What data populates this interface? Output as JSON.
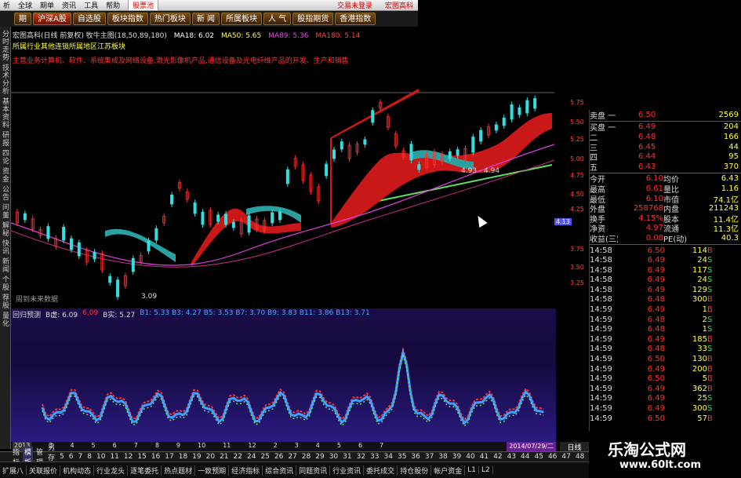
{
  "menubar": {
    "items": [
      "析",
      "全球",
      "期单",
      "资讯",
      "工具",
      "帮助"
    ],
    "brand": "股票池",
    "marquee": [
      "交易未登录",
      "宏图高科"
    ]
  },
  "navbar": {
    "items": [
      "期",
      "沪深A股",
      "自选股",
      "板块指数",
      "热门板块",
      "新 闻",
      "所属板块",
      "人 气",
      "股指期货",
      "香港指数"
    ],
    "active_index": 1
  },
  "left_tabs": [
    "分时走势",
    "技术分析",
    "基本资料",
    "研报",
    "四论",
    "资金",
    "公告",
    "问董",
    "解秘",
    "快讯",
    "新闻",
    "个股",
    "荐股",
    "量化"
  ],
  "chart_header": {
    "stock": "宏图高科(日线 前复权) 牧牛主图(18,50,89,180)",
    "ma18": "MA18: 6.02",
    "ma50": "MA50: 5.65",
    "ma89": "MA89: 5.36",
    "ma180": "MA180: 5.14"
  },
  "indicator": {
    "info": "所属行业其他连锁所属地区江苏板块",
    "desc": "主营业务计算机、软件、系统集成及网络设备,激光影像机产品,通信设备及光电纤维产品的开发、生产和销售"
  },
  "annotations": {
    "low": "3.09",
    "support": "4.93 - 4.94",
    "future": "周到未来数据"
  },
  "price_axis": {
    "ticks": [
      "5.75",
      "5.50",
      "5.25",
      "5.00",
      "4.75",
      "4.50",
      "4.25",
      "4.13",
      "3.75",
      "3.50",
      "3.25"
    ],
    "highlight": "4.13"
  },
  "sub_header": {
    "name": "回归预测",
    "b1": "B虚: 6.09",
    "b1v": "6.09",
    "b2": "B实: 5.27",
    "bvals": "B1: 5.33  B3: 4.27  B5: 3.53  B7: 3.70  B9: 3.83  B11: 3.86  B13: 3.71"
  },
  "quote": {
    "asks": [
      {
        "label": "卖盘 一",
        "price": "6.50",
        "vol": "2569"
      }
    ],
    "bids": [
      {
        "label": "买盘 一",
        "price": "6.49",
        "vol": "204"
      },
      {
        "label": "二",
        "price": "6.48",
        "vol": "166"
      },
      {
        "label": "三",
        "price": "6.45",
        "vol": "44"
      },
      {
        "label": "四",
        "price": "6.44",
        "vol": "95"
      },
      {
        "label": "五",
        "price": "6.43",
        "vol": "370"
      }
    ],
    "stats": [
      [
        "今开",
        "6.10",
        "均价",
        "6.43"
      ],
      [
        "最高",
        "6.61",
        "量比",
        "1.16"
      ],
      [
        "最低",
        "6.10",
        "市值",
        "74.1亿"
      ],
      [
        "外盘",
        "258768",
        "内盘",
        "211243"
      ],
      [
        "换手",
        "4.15%",
        "股本",
        "11.4亿"
      ],
      [
        "净资",
        "4.97",
        "流通",
        "11.3亿"
      ],
      [
        "收益(三)",
        "0.08",
        "PE(动)",
        "40.3"
      ]
    ],
    "ticks": [
      [
        "14:58",
        "6.50",
        "114",
        "B"
      ],
      [
        "14:58",
        "6.49",
        "24",
        "S"
      ],
      [
        "14:58",
        "6.49",
        "117",
        "S"
      ],
      [
        "14:58",
        "6.49",
        "24",
        "S"
      ],
      [
        "14:58",
        "6.49",
        "129",
        "S"
      ],
      [
        "14:58",
        "6.48",
        "300",
        "B"
      ],
      [
        "14:59",
        "6.49",
        "1",
        "B"
      ],
      [
        "14:59",
        "6.48",
        "2",
        "S"
      ],
      [
        "14:59",
        "6.48",
        "1",
        "S"
      ],
      [
        "14:59",
        "6.49",
        "185",
        "B"
      ],
      [
        "14:59",
        "6.48",
        "33",
        "S"
      ],
      [
        "14:59",
        "6.50",
        "130",
        "B"
      ],
      [
        "14:59",
        "6.49",
        "200",
        "B"
      ],
      [
        "14:59",
        "6.50",
        "5",
        "B"
      ],
      [
        "14:59",
        "6.49",
        "362",
        "B"
      ],
      [
        "14:59",
        "6.49",
        "25",
        "S"
      ],
      [
        "14:59",
        "6.49",
        "300",
        "S"
      ],
      [
        "14:59",
        "6.50",
        "57",
        "B"
      ]
    ]
  },
  "datebar": {
    "ticks": [
      "2013",
      "3",
      "4",
      "5",
      "6",
      "7",
      "8",
      "9",
      "10",
      "11",
      "12",
      "2",
      "3",
      "4",
      "5",
      "6",
      "7"
    ],
    "current": "2014/07/29/二"
  },
  "tabbar1": [
    "指标",
    "模板",
    "管理",
    "另存为",
    "5",
    "6",
    "7",
    "8",
    "10",
    "11",
    "12",
    "15",
    "16",
    "17",
    "18",
    "19",
    "20",
    "21",
    "22",
    "24",
    "25",
    "26",
    "27",
    "28",
    "29",
    "30",
    "31",
    "32",
    "33",
    "34",
    "35",
    "36",
    "37",
    "38",
    "39",
    "40",
    "41",
    "42",
    "43",
    "44",
    "45",
    "46",
    "47",
    "48",
    "49",
    "50",
    "L1",
    "L2"
  ],
  "tabbar2": [
    "扩展八",
    "关联报价",
    "机构动态",
    "行业龙头",
    "逐笔委托",
    "热点题材",
    "一致预期",
    "经济指标",
    "综合资讯",
    "同题资讯",
    "行业资讯",
    "委托成交",
    "持仓股份",
    "帐户资金",
    "L1",
    "L2"
  ],
  "right_tab": "日线",
  "watermark": {
    "site": "乐淘公式网",
    "url": "www.60lt.com"
  },
  "colors": {
    "up": "#ff3030",
    "down": "#30e0e0",
    "ma_line": "#e040e0",
    "support_line": "#60e060",
    "channel": "#c81818"
  }
}
